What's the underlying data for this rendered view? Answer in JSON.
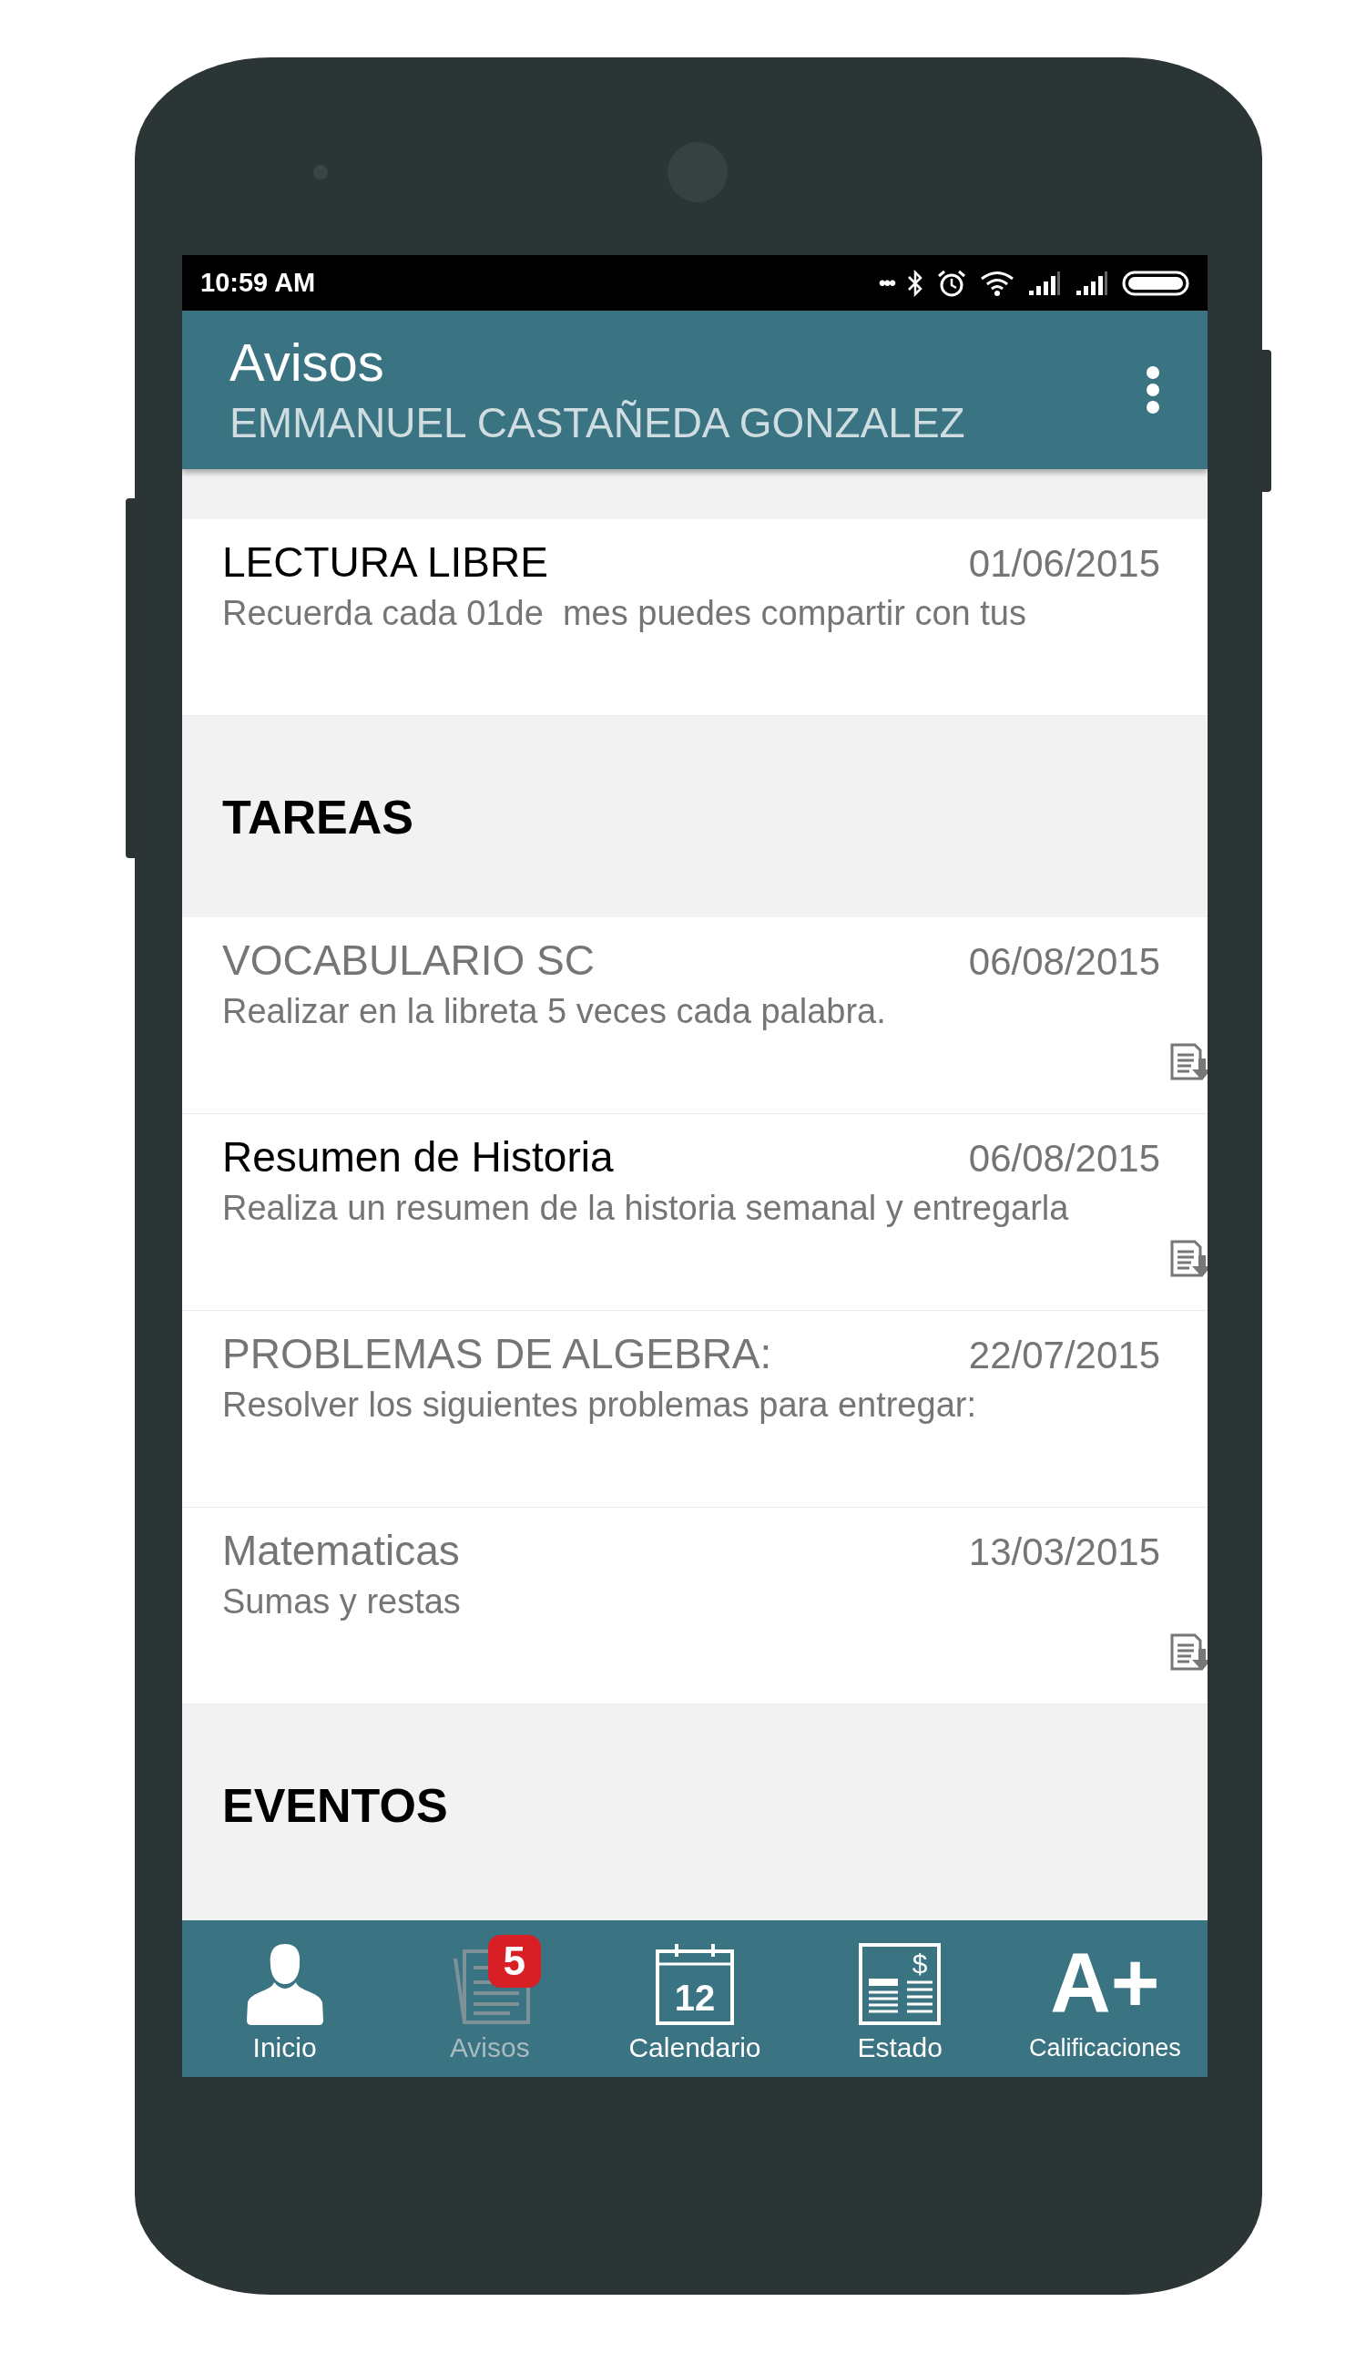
{
  "status_bar": {
    "time": "10:59 AM",
    "dots": "•••"
  },
  "app_bar": {
    "title": "Avisos",
    "subtitle": "EMMANUEL CASTAÑEDA GONZALEZ"
  },
  "list": [
    {
      "kind": "item",
      "title": "LECTURA LIBRE",
      "date": "01/06/2015",
      "description": "Recuerda cada 01de  mes puedes compartir con tus",
      "read": false,
      "attachment": false
    },
    {
      "kind": "header",
      "title": "TAREAS"
    },
    {
      "kind": "item",
      "title": "VOCABULARIO SC",
      "date": "06/08/2015",
      "description": "Realizar en la libreta 5 veces cada palabra.",
      "read": true,
      "attachment": true
    },
    {
      "kind": "item",
      "title": "Resumen de Historia",
      "date": "06/08/2015",
      "description": "Realiza un resumen de la historia semanal y entregarla",
      "read": false,
      "attachment": true
    },
    {
      "kind": "item",
      "title": "PROBLEMAS DE ALGEBRA:",
      "date": "22/07/2015",
      "description": "Resolver los siguientes problemas para entregar:",
      "read": true,
      "attachment": false
    },
    {
      "kind": "item",
      "title": "Matematicas",
      "date": "13/03/2015",
      "description": "Sumas y restas",
      "read": true,
      "attachment": true
    },
    {
      "kind": "header",
      "title": "EVENTOS"
    }
  ],
  "tabs": [
    {
      "label": "Inicio",
      "selected": false
    },
    {
      "label": "Avisos",
      "selected": true,
      "badge": "5"
    },
    {
      "label": "Calendario",
      "selected": false,
      "icon_text": "12"
    },
    {
      "label": "Estado",
      "selected": false,
      "icon_text": "$"
    },
    {
      "label": "Calificaciones",
      "selected": false,
      "icon_text": "A+"
    }
  ]
}
